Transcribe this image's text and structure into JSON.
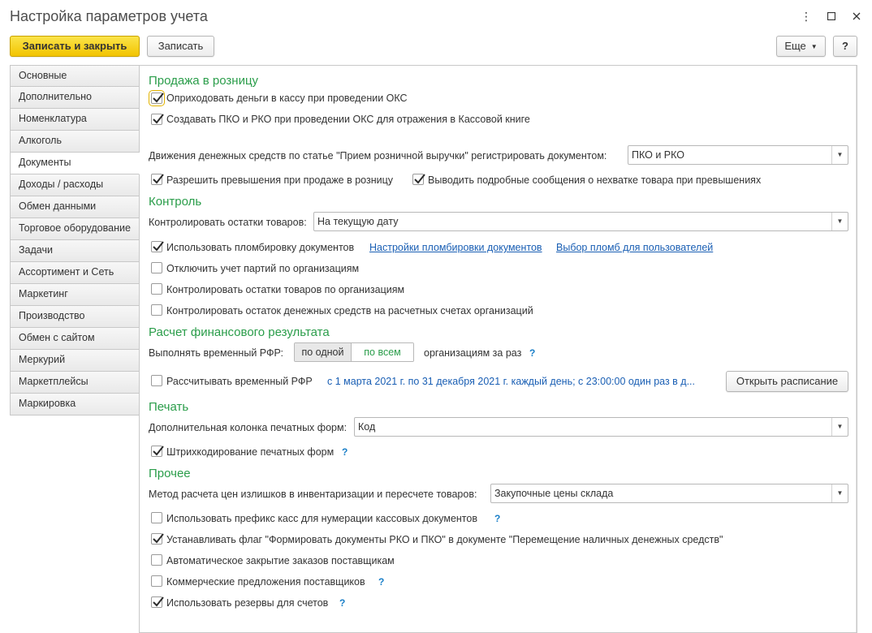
{
  "window": {
    "title": "Настройка параметров учета",
    "buttons": {
      "menu": "⋮",
      "maximize": "☐",
      "close": "✕"
    }
  },
  "toolbar": {
    "save_close": "Записать и закрыть",
    "save": "Записать",
    "more": "Еще",
    "help": "?"
  },
  "nav": {
    "items": [
      "Основные",
      "Дополнительно",
      "Номенклатура",
      "Алкоголь",
      "Документы",
      "Доходы / расходы",
      "Обмен данными",
      "Торговое оборудование",
      "Задачи",
      "Ассортимент и Сеть",
      "Маркетинг",
      "Производство",
      "Обмен с сайтом",
      "Меркурий",
      "Маркетплейсы",
      "Маркировка"
    ],
    "active_index": 4
  },
  "retail": {
    "heading": "Продажа в розницу",
    "cb1": {
      "label": "Оприходовать деньги в кассу при проведении ОКС",
      "checked": true
    },
    "cb2": {
      "label": "Создавать ПКО и РКО при проведении ОКС для отражения в Кассовой книге",
      "checked": true
    },
    "movement_label": "Движения денежных средств по статье \"Прием розничной выручки\" регистрировать документом:",
    "movement_value": "ПКО и РКО",
    "cb3": {
      "label": "Разрешить превышения при продаже в розницу",
      "checked": true
    },
    "cb4": {
      "label": "Выводить подробные сообщения о нехватке товара при превышениях",
      "checked": true
    }
  },
  "control": {
    "heading": "Контроль",
    "stock_label": "Контролировать остатки товаров:",
    "stock_value": "На текущую дату",
    "cb_seal": {
      "label": "Использовать пломбировку документов",
      "checked": true
    },
    "link_seal_settings": "Настройки пломбировки документов",
    "link_seal_select": "Выбор пломб для пользователей",
    "cb_batches": {
      "label": "Отключить учет партий по организациям",
      "checked": false
    },
    "cb_stock_org": {
      "label": "Контролировать остатки товаров по организациям",
      "checked": false
    },
    "cb_cash_org": {
      "label": "Контролировать остаток денежных средств на расчетных счетах организаций",
      "checked": false
    }
  },
  "financial": {
    "heading": "Расчет финансового результата",
    "rfr_label": "Выполнять временный РФР:",
    "seg_one": "по одной",
    "seg_all": "по всем",
    "rfr_suffix": "организациям за раз",
    "help": "?",
    "cb_calc": {
      "label": "Рассчитывать временный РФР",
      "checked": false
    },
    "schedule_text": "с 1 марта 2021 г. по 31 декабря 2021 г. каждый день; с 23:00:00 один раз в д...",
    "open_schedule": "Открыть расписание"
  },
  "print": {
    "heading": "Печать",
    "column_label": "Дополнительная колонка печатных форм:",
    "column_value": "Код",
    "cb_barcode": {
      "label": "Штрихкодирование печатных форм",
      "checked": true
    },
    "help": "?"
  },
  "other": {
    "heading": "Прочее",
    "method_label": "Метод расчета цен излишков в инвентаризации и пересчете товаров:",
    "method_value": "Закупочные цены склада",
    "cb_prefix": {
      "label": "Использовать префикс касс для нумерации кассовых документов",
      "checked": false
    },
    "cb_flag": {
      "label": "Устанавливать флаг \"Формировать документы РКО и ПКО\" в документе \"Перемещение наличных денежных средств\"",
      "checked": true
    },
    "cb_autoclose": {
      "label": "Автоматическое закрытие заказов поставщикам",
      "checked": false
    },
    "cb_offers": {
      "label": "Коммерческие предложения поставщиков",
      "checked": false
    },
    "cb_reserves": {
      "label": "Использовать резервы для счетов",
      "checked": true
    },
    "help": "?"
  },
  "colors": {
    "accent_green": "#2a9d4a",
    "primary_yellow": "#f2c400",
    "link_blue": "#1a5fb4"
  }
}
